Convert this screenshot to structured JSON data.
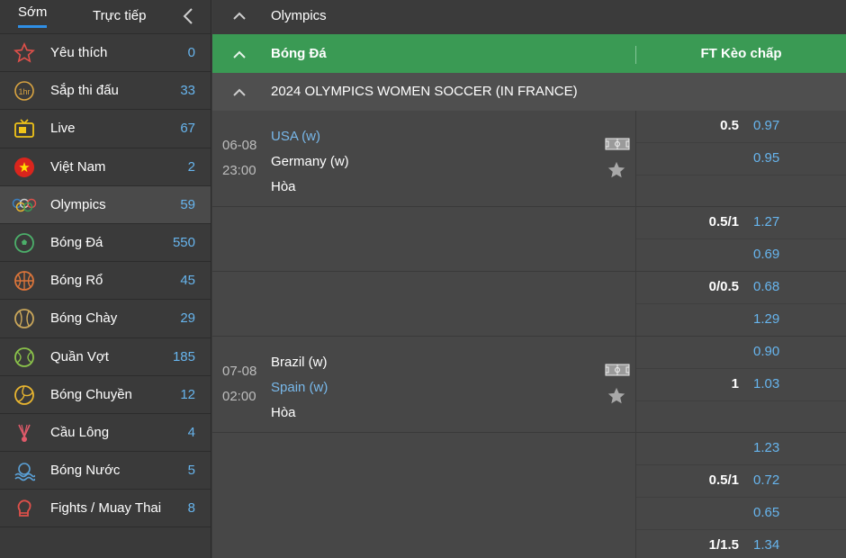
{
  "tabs": {
    "early": "Sớm",
    "live": "Trực tiếp"
  },
  "colors": {
    "accent_blue": "#2f8fe6",
    "count_blue": "#67b5ee",
    "header_green": "#3a9a54"
  },
  "sports": [
    {
      "icon": "star-icon",
      "label": "Yêu thích",
      "count": "0"
    },
    {
      "icon": "clock-1hr-icon",
      "label": "Sắp thi đấu",
      "count": "33"
    },
    {
      "icon": "tv-icon",
      "label": "Live",
      "count": "67"
    },
    {
      "icon": "vietnam-flag-icon",
      "label": "Việt Nam",
      "count": "2"
    },
    {
      "icon": "olympic-rings-icon",
      "label": "Olympics",
      "count": "59"
    },
    {
      "icon": "soccer-ball-icon",
      "label": "Bóng Đá",
      "count": "550"
    },
    {
      "icon": "basketball-icon",
      "label": "Bóng Rổ",
      "count": "45"
    },
    {
      "icon": "baseball-icon",
      "label": "Bóng Chày",
      "count": "29"
    },
    {
      "icon": "tennis-ball-icon",
      "label": "Quần Vợt",
      "count": "185"
    },
    {
      "icon": "volleyball-icon",
      "label": "Bóng Chuyền",
      "count": "12"
    },
    {
      "icon": "shuttlecock-icon",
      "label": "Cầu Lông",
      "count": "4"
    },
    {
      "icon": "water-polo-icon",
      "label": "Bóng Nước",
      "count": "5"
    },
    {
      "icon": "boxing-glove-icon",
      "label": "Fights / Muay Thai",
      "count": "8"
    }
  ],
  "breadcrumb": "Olympics",
  "sport_header": {
    "title": "Bóng Đá",
    "market": "FT Kèo chấp"
  },
  "league": "2024 OLYMPICS WOMEN SOCCER (IN FRANCE)",
  "matches": [
    {
      "date": "06-08",
      "time": "23:00",
      "home": "USA (w)",
      "away": "Germany (w)",
      "draw": "Hòa"
    },
    {
      "date": "07-08",
      "time": "02:00",
      "home": "Brazil (w)",
      "away": "Spain (w)",
      "draw": "Hòa"
    }
  ],
  "odds": [
    {
      "hcap": "0.5",
      "price": "0.97"
    },
    {
      "hcap": "",
      "price": "0.95"
    },
    {
      "hcap": "",
      "price": ""
    },
    {
      "hcap": "0.5/1",
      "price": "1.27"
    },
    {
      "hcap": "",
      "price": "0.69"
    },
    {
      "hcap": "0/0.5",
      "price": "0.68"
    },
    {
      "hcap": "",
      "price": "1.29"
    },
    {
      "hcap": "",
      "price": "0.90"
    },
    {
      "hcap": "1",
      "price": "1.03"
    },
    {
      "hcap": "",
      "price": ""
    },
    {
      "hcap": "",
      "price": "1.23"
    },
    {
      "hcap": "0.5/1",
      "price": "0.72"
    },
    {
      "hcap": "",
      "price": "0.65"
    },
    {
      "hcap": "1/1.5",
      "price": "1.34"
    }
  ]
}
